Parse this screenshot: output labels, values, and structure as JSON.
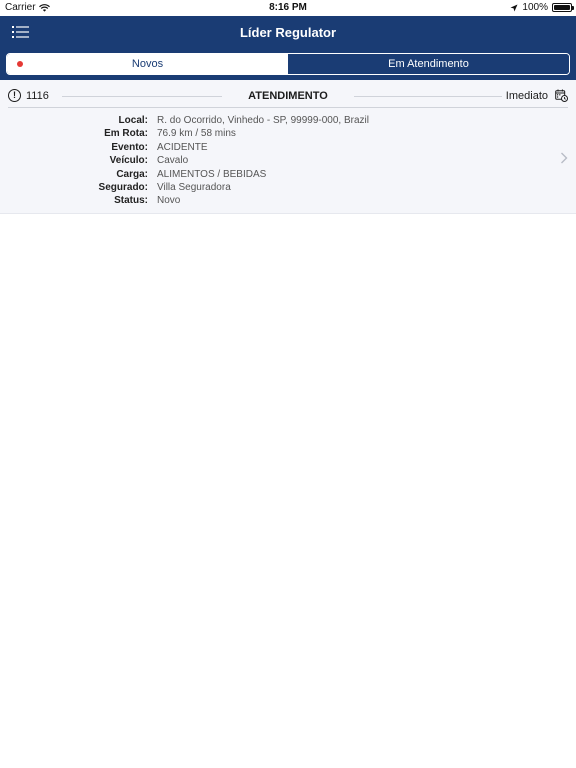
{
  "status_bar": {
    "carrier": "Carrier",
    "time": "8:16 PM",
    "battery": "100%",
    "battery_level": 1.0
  },
  "header": {
    "title": "Líder Regulator",
    "menu_icon": "list-menu-icon"
  },
  "tabs": [
    {
      "label": "Novos",
      "selected": true,
      "badge": "red-dot"
    },
    {
      "label": "Em Atendimento",
      "selected": false
    }
  ],
  "card": {
    "id": "1116",
    "title": "ATENDIMENTO",
    "priority": "Imediato",
    "fields": [
      {
        "label": "Local:",
        "value": "R. do Ocorrido, Vinhedo - SP, 99999-000, Brazil"
      },
      {
        "label": "Em Rota:",
        "value": "76.9 km / 58 mins"
      },
      {
        "label": "Evento:",
        "value": "ACIDENTE"
      },
      {
        "label": "Veículo:",
        "value": "Cavalo"
      },
      {
        "label": "Carga:",
        "value": "ALIMENTOS / BEBIDAS"
      },
      {
        "label": "Segurado:",
        "value": "Villa Seguradora"
      },
      {
        "label": "Status:",
        "value": "Novo"
      }
    ]
  },
  "colors": {
    "brand": "#1a3c74",
    "badge": "#e53935",
    "card_bg": "#f5f6fa"
  }
}
